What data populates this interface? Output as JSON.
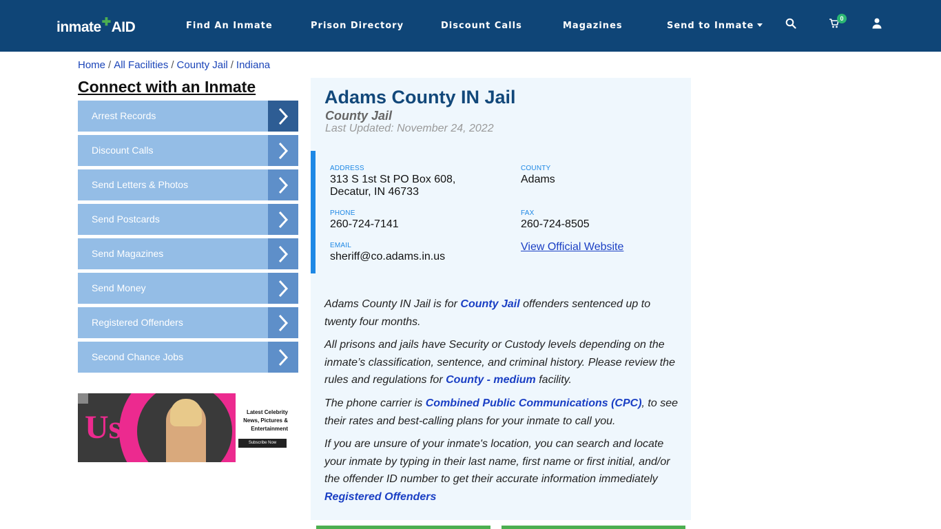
{
  "header": {
    "logo_text": "inmate",
    "logo_accent": "AID",
    "nav": [
      {
        "label": "Find An Inmate"
      },
      {
        "label": "Prison Directory"
      },
      {
        "label": "Discount Calls"
      },
      {
        "label": "Magazines"
      },
      {
        "label": "Send to Inmate"
      }
    ],
    "cart_count": "0",
    "colors": {
      "bar": "#0f4577",
      "badge": "#2bb673"
    }
  },
  "breadcrumb": [
    {
      "label": "Home"
    },
    {
      "label": "All Facilities"
    },
    {
      "label": "County Jail"
    },
    {
      "label": "Indiana"
    }
  ],
  "sidebar": {
    "title": "Connect with an Inmate",
    "items": [
      {
        "label": "Arrest Records"
      },
      {
        "label": "Discount Calls"
      },
      {
        "label": "Send Letters & Photos"
      },
      {
        "label": "Send Postcards"
      },
      {
        "label": "Send Magazines"
      },
      {
        "label": "Send Money"
      },
      {
        "label": "Registered Offenders"
      },
      {
        "label": "Second Chance Jobs"
      }
    ],
    "ad": {
      "brand": "Us",
      "tagline": "Latest Celebrity News, Pictures & Entertainment",
      "cta": "Subscribe Now"
    }
  },
  "facility": {
    "title": "Adams County IN Jail",
    "type": "County Jail",
    "updated": "Last Updated: November 24, 2022",
    "address_label": "ADDRESS",
    "address_line1": "313 S 1st St PO Box 608,",
    "address_line2": "Decatur, IN 46733",
    "county_label": "COUNTY",
    "county": "Adams",
    "phone_label": "PHONE",
    "phone": "260-724-7141",
    "fax_label": "FAX",
    "fax": "260-724-8505",
    "email_label": "EMAIL",
    "email": "sheriff@co.adams.in.us",
    "website_link": "View Official Website"
  },
  "description": {
    "p1_a": "Adams County IN Jail is for ",
    "p1_link": "County Jail",
    "p1_b": " offenders sentenced up to twenty four months.",
    "p2_a": "All prisons and jails have Security or Custody levels depending on the inmate’s classification, sentence, and criminal history. Please review the rules and regulations for ",
    "p2_link": "County - medium",
    "p2_b": " facility.",
    "p3_a": "The phone carrier is ",
    "p3_link": "Combined Public Communications (CPC)",
    "p3_b": ", to see their rates and best-calling plans for your inmate to call you.",
    "p4_a": "If you are unsure of your inmate's location, you can search and locate your inmate by typing in their last name, first name or first initial, and/or the offender ID number to get their accurate information immediately",
    "p4_link": "Registered Offenders"
  }
}
